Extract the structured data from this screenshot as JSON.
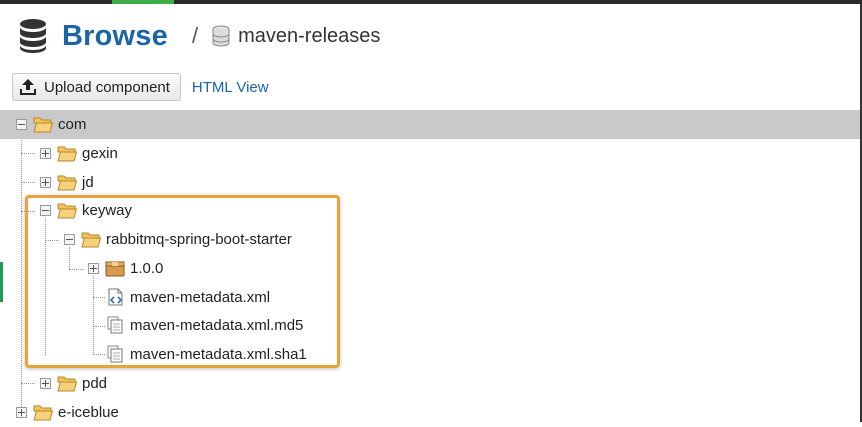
{
  "header": {
    "title": "Browse",
    "separator": "/",
    "repository": "maven-releases"
  },
  "toolbar": {
    "upload_label": "Upload component",
    "html_view_label": "HTML View"
  },
  "tree": {
    "com": "com",
    "gexin": "gexin",
    "jd": "jd",
    "keyway": "keyway",
    "artifact": "rabbitmq-spring-boot-starter",
    "version": "1.0.0",
    "metadata_xml": "maven-metadata.xml",
    "metadata_md5": "maven-metadata.xml.md5",
    "metadata_sha1": "maven-metadata.xml.sha1",
    "pdd": "pdd",
    "eiceblue": "e-iceblue"
  },
  "colors": {
    "title": "#1a65a8",
    "link": "#1a65a8",
    "selection": "#c9c9c9",
    "highlight_border": "#e8a33d",
    "folder": "#f3c45d"
  }
}
